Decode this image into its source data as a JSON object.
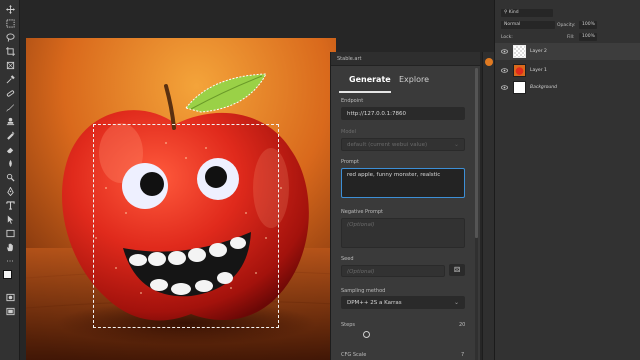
{
  "stable_art": {
    "panel_title": "Stable.art",
    "tabs": [
      {
        "label": "Generate",
        "active": true
      },
      {
        "label": "Explore",
        "active": false
      }
    ],
    "endpoint": {
      "label": "Endpoint",
      "value": "http://127.0.0.1:7860"
    },
    "model": {
      "label": "Model",
      "value": "default (current webui value)"
    },
    "prompt": {
      "label": "Prompt",
      "value": "red apple, funny monster, realstic"
    },
    "negative_prompt": {
      "label": "Negative Prompt",
      "placeholder": "(Optional)"
    },
    "seed": {
      "label": "Seed",
      "placeholder": "(Optional)"
    },
    "sampling": {
      "label": "Sampling method",
      "value": "DPM++ 2S a Karras"
    },
    "steps": {
      "label": "Steps",
      "value": "20"
    },
    "cfg": {
      "label": "CFG Scale",
      "value": "7"
    }
  },
  "layers_panel": {
    "kind_label": "Kind",
    "blend_mode": "Normal",
    "opacity_label": "Opacity:",
    "opacity_value": "100%",
    "lock_label": "Lock:",
    "fill_label": "Fill:",
    "fill_value": "100%",
    "layers": [
      {
        "name": "Layer 2",
        "selected": true
      },
      {
        "name": "Layer 1",
        "selected": false
      },
      {
        "name": "Background",
        "selected": false
      }
    ]
  },
  "colors": {
    "accent_focus": "#3d8fd6",
    "panel_bg": "#3a3a3a",
    "apple_red": "#d8241b",
    "wood_orange": "#e07a22"
  },
  "icons": [
    "move-icon",
    "marquee-icon",
    "lasso-icon",
    "crop-icon",
    "eyedropper-icon",
    "brush-icon",
    "stamp-icon",
    "eraser-icon",
    "gradient-icon",
    "dodge-icon",
    "pen-icon",
    "type-icon",
    "path-select-icon",
    "shape-icon",
    "hand-icon",
    "zoom-icon",
    "more-icon",
    "color-swatches",
    "quick-mask-icon",
    "screen-mode-icon",
    "eye-icon",
    "seed-dice-icon",
    "chevron-down-icon"
  ]
}
